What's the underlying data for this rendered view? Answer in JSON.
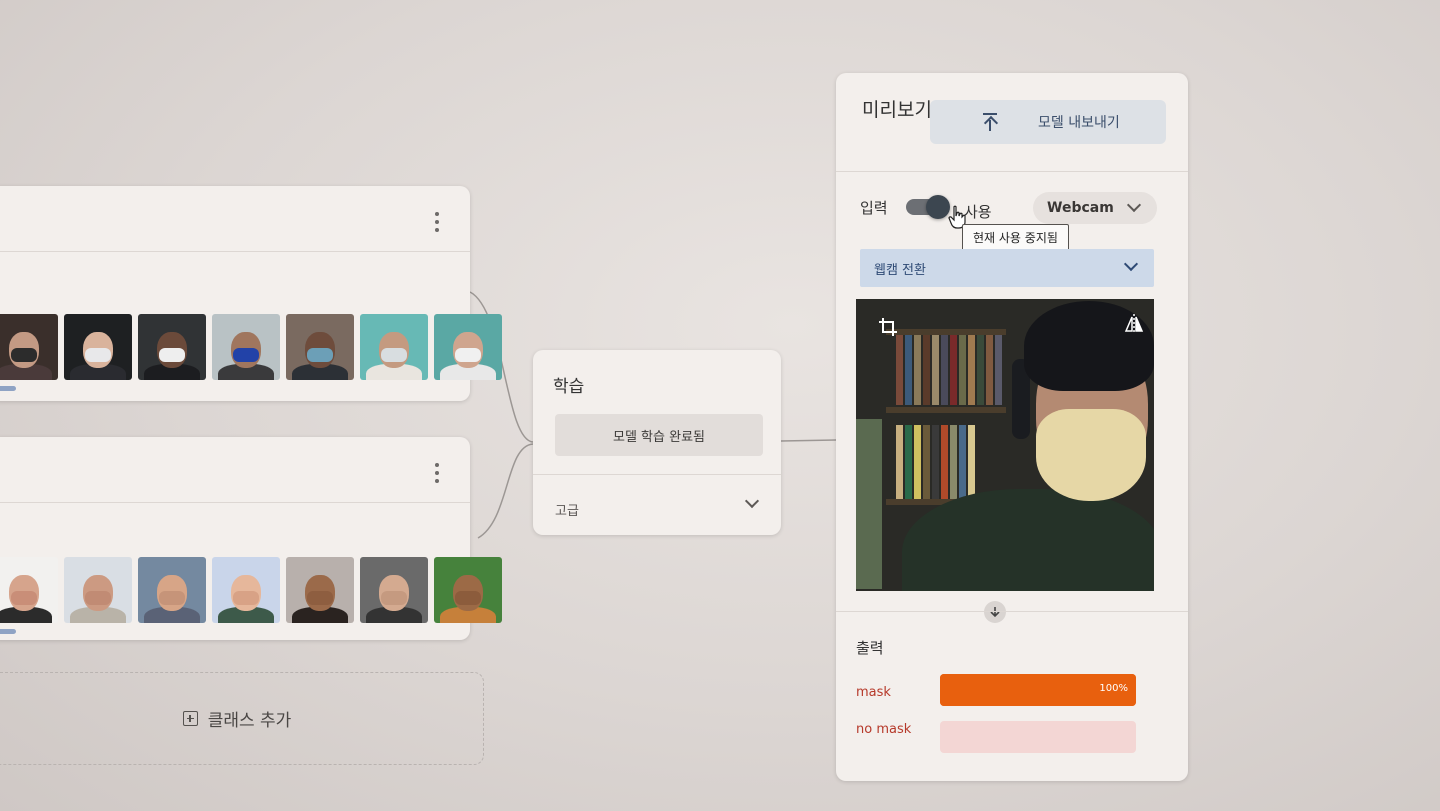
{
  "classes": [
    {
      "thumbs": [
        {
          "bg": "#3a2f2b",
          "skin": "#c39a84",
          "mask": "#2c2c2c",
          "body": "#4a3a3a"
        },
        {
          "bg": "#1e2022",
          "skin": "#d9b39c",
          "mask": "#e8e8ea",
          "body": "#2a2b30"
        },
        {
          "bg": "#303335",
          "skin": "#6b4a3a",
          "mask": "#eeeeee",
          "body": "#1c1d20"
        },
        {
          "bg": "#b9c2c5",
          "skin": "#a0765e",
          "mask": "#2242a8",
          "body": "#3a3a3c"
        },
        {
          "bg": "#7a6a60",
          "skin": "#6e4c3c",
          "mask": "#6c9fb7",
          "body": "#2c3036"
        },
        {
          "bg": "#67b9b5",
          "skin": "#c49a80",
          "mask": "#d8dde0",
          "body": "#e9e5df"
        },
        {
          "bg": "#5aa8a4",
          "skin": "#cfa58e",
          "mask": "#f0f0f0",
          "body": "#e8e8e8"
        }
      ]
    },
    {
      "thumbs": [
        {
          "bg": "#f2f1ef",
          "skin": "#d6a48c",
          "mask": "#c98e78",
          "body": "#2b2b2b"
        },
        {
          "bg": "#d9dee4",
          "skin": "#cc9a82",
          "mask": "#c18b74",
          "body": "#b9b3a8"
        },
        {
          "bg": "#7489a0",
          "skin": "#d7a587",
          "mask": "#c69479",
          "body": "#5a6276"
        },
        {
          "bg": "#c9d5ea",
          "skin": "#e6b79b",
          "mask": "#d8a286",
          "body": "#3d5a4a"
        },
        {
          "bg": "#b8b0ac",
          "skin": "#9b6a4a",
          "mask": "#8e5e40",
          "body": "#2a2320"
        },
        {
          "bg": "#6a6a6a",
          "skin": "#d4aa90",
          "mask": "#c59a80",
          "body": "#333333"
        },
        {
          "bg": "#46823c",
          "skin": "#9c6a46",
          "mask": "#8c5c3c",
          "body": "#c6803a"
        }
      ]
    }
  ],
  "add_class": {
    "label": "클래스 추가"
  },
  "training": {
    "title": "학습",
    "button_label": "모델 학습 완료됨",
    "advanced_label": "고급"
  },
  "preview": {
    "title": "미리보기",
    "export_label": "모델 내보내기",
    "input_label": "입력",
    "toggle_state": "on",
    "toggle_label": "사용",
    "tooltip": "현재 사용 중지됨",
    "source_value": "Webcam",
    "switch_label": "웹캠 전환",
    "output_label": "출력",
    "outputs": [
      {
        "name": "mask",
        "percent_text": "100%",
        "confidence": 1.0,
        "color": "#e8600e",
        "track": "#e8600e"
      },
      {
        "name": "no mask",
        "percent_text": "",
        "confidence": 0.0,
        "color": "#e8600e",
        "track": "#f3d6d4"
      }
    ]
  }
}
